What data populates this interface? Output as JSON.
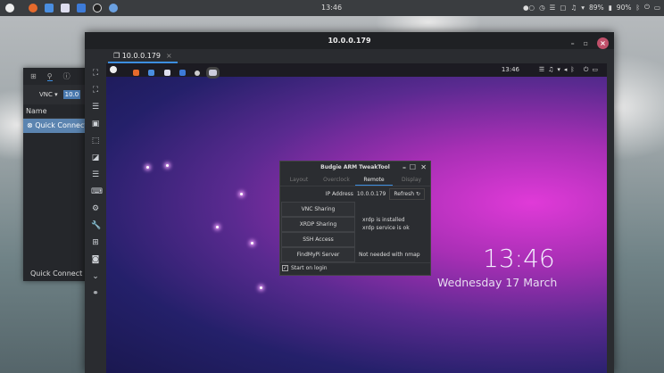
{
  "top_panel": {
    "clock": "13:46",
    "battery1": "89%",
    "battery2": "90%"
  },
  "viewer": {
    "title": "10.0.0.179",
    "tab_label": "10.0.0.179",
    "close_glyph": "×"
  },
  "remote": {
    "panel_clock": "13:46",
    "clock": "13:46",
    "date": "Wednesday 17 March"
  },
  "dialog": {
    "title": "Budgie ARM TweakTool",
    "tabs": [
      "Layout",
      "Overclock",
      "Remote",
      "Display"
    ],
    "active_tab": "Remote",
    "ip_label": "IP Address",
    "ip_value": "10.0.0.179",
    "refresh_label": "Refresh",
    "buttons": [
      "VNC Sharing",
      "XRDP Sharing",
      "SSH Access",
      "FindMyPi Server"
    ],
    "xrdp_status_1": "xrdp is installed",
    "xrdp_status_2": "xrdp service is ok",
    "findmypi_status": "Not needed with nmap",
    "start_on_login": "Start on login",
    "start_on_login_checked": true
  },
  "remmina": {
    "protocol": "VNC ▾",
    "address_value": "10.0",
    "column_name": "Name",
    "item": "Quick Connect",
    "footer": "Quick Connect (/"
  },
  "colors": {
    "accent": "#3d8ee0",
    "close": "#c0506a",
    "selection": "#5b84b0"
  }
}
